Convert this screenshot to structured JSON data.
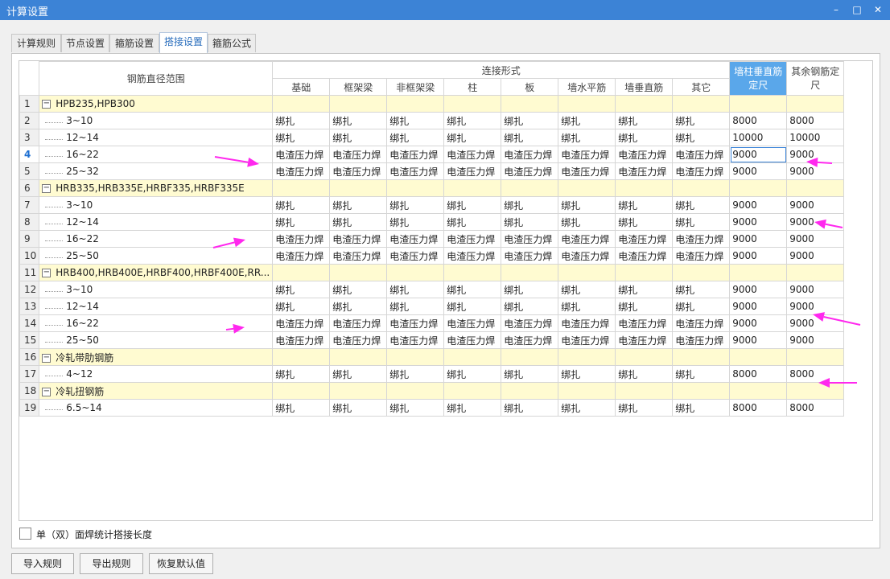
{
  "window": {
    "title": "计算设置",
    "minimize_icon": "minimize-icon",
    "maximize_icon": "maximize-icon",
    "close_icon": "close-icon",
    "accent": "#3c83d6"
  },
  "tabs": [
    {
      "label": "计算规则"
    },
    {
      "label": "节点设置"
    },
    {
      "label": "箍筋设置"
    },
    {
      "label": "搭接设置",
      "active": true
    },
    {
      "label": "箍筋公式"
    }
  ],
  "grid": {
    "header": {
      "range": "钢筋直径范围",
      "group": "连接形式",
      "cols": [
        "基础",
        "框架梁",
        "非框架梁",
        "柱",
        "板",
        "墙水平筋",
        "墙垂直筋",
        "其它"
      ],
      "wall_len": "墙柱垂直筋定尺",
      "other_len": "其余钢筋定尺"
    },
    "rows": [
      {
        "n": "1",
        "type": "group",
        "label": "HPB235,HPB300"
      },
      {
        "n": "2",
        "label": "3~10",
        "c": [
          "绑扎",
          "绑扎",
          "绑扎",
          "绑扎",
          "绑扎",
          "绑扎",
          "绑扎",
          "绑扎"
        ],
        "a": "8000",
        "b": "8000"
      },
      {
        "n": "3",
        "label": "12~14",
        "c": [
          "绑扎",
          "绑扎",
          "绑扎",
          "绑扎",
          "绑扎",
          "绑扎",
          "绑扎",
          "绑扎"
        ],
        "a": "10000",
        "b": "10000"
      },
      {
        "n": "4",
        "label": "16~22",
        "c": [
          "电渣压力焊",
          "电渣压力焊",
          "电渣压力焊",
          "电渣压力焊",
          "电渣压力焊",
          "电渣压力焊",
          "电渣压力焊",
          "电渣压力焊"
        ],
        "a": "9000",
        "b": "9000",
        "selected": true
      },
      {
        "n": "5",
        "label": "25~32",
        "c": [
          "电渣压力焊",
          "电渣压力焊",
          "电渣压力焊",
          "电渣压力焊",
          "电渣压力焊",
          "电渣压力焊",
          "电渣压力焊",
          "电渣压力焊"
        ],
        "a": "9000",
        "b": "9000"
      },
      {
        "n": "6",
        "type": "group",
        "label": "HRB335,HRB335E,HRBF335,HRBF335E"
      },
      {
        "n": "7",
        "label": "3~10",
        "c": [
          "绑扎",
          "绑扎",
          "绑扎",
          "绑扎",
          "绑扎",
          "绑扎",
          "绑扎",
          "绑扎"
        ],
        "a": "9000",
        "b": "9000"
      },
      {
        "n": "8",
        "label": "12~14",
        "c": [
          "绑扎",
          "绑扎",
          "绑扎",
          "绑扎",
          "绑扎",
          "绑扎",
          "绑扎",
          "绑扎"
        ],
        "a": "9000",
        "b": "9000"
      },
      {
        "n": "9",
        "label": "16~22",
        "c": [
          "电渣压力焊",
          "电渣压力焊",
          "电渣压力焊",
          "电渣压力焊",
          "电渣压力焊",
          "电渣压力焊",
          "电渣压力焊",
          "电渣压力焊"
        ],
        "a": "9000",
        "b": "9000"
      },
      {
        "n": "10",
        "label": "25~50",
        "c": [
          "电渣压力焊",
          "电渣压力焊",
          "电渣压力焊",
          "电渣压力焊",
          "电渣压力焊",
          "电渣压力焊",
          "电渣压力焊",
          "电渣压力焊"
        ],
        "a": "9000",
        "b": "9000"
      },
      {
        "n": "11",
        "type": "group",
        "label": "HRB400,HRB400E,HRBF400,HRBF400E,RR..."
      },
      {
        "n": "12",
        "label": "3~10",
        "c": [
          "绑扎",
          "绑扎",
          "绑扎",
          "绑扎",
          "绑扎",
          "绑扎",
          "绑扎",
          "绑扎"
        ],
        "a": "9000",
        "b": "9000"
      },
      {
        "n": "13",
        "label": "12~14",
        "c": [
          "绑扎",
          "绑扎",
          "绑扎",
          "绑扎",
          "绑扎",
          "绑扎",
          "绑扎",
          "绑扎"
        ],
        "a": "9000",
        "b": "9000"
      },
      {
        "n": "14",
        "label": "16~22",
        "c": [
          "电渣压力焊",
          "电渣压力焊",
          "电渣压力焊",
          "电渣压力焊",
          "电渣压力焊",
          "电渣压力焊",
          "电渣压力焊",
          "电渣压力焊"
        ],
        "a": "9000",
        "b": "9000"
      },
      {
        "n": "15",
        "label": "25~50",
        "c": [
          "电渣压力焊",
          "电渣压力焊",
          "电渣压力焊",
          "电渣压力焊",
          "电渣压力焊",
          "电渣压力焊",
          "电渣压力焊",
          "电渣压力焊"
        ],
        "a": "9000",
        "b": "9000"
      },
      {
        "n": "16",
        "type": "group",
        "label": "冷轧带肋钢筋"
      },
      {
        "n": "17",
        "label": "4~12",
        "c": [
          "绑扎",
          "绑扎",
          "绑扎",
          "绑扎",
          "绑扎",
          "绑扎",
          "绑扎",
          "绑扎"
        ],
        "a": "8000",
        "b": "8000"
      },
      {
        "n": "18",
        "type": "group",
        "label": "冷轧扭钢筋"
      },
      {
        "n": "19",
        "label": "6.5~14",
        "c": [
          "绑扎",
          "绑扎",
          "绑扎",
          "绑扎",
          "绑扎",
          "绑扎",
          "绑扎",
          "绑扎"
        ],
        "a": "8000",
        "b": "8000"
      }
    ]
  },
  "checkbox": {
    "label": "单（双）面焊统计搭接长度",
    "checked": false
  },
  "buttons": {
    "import": "导入规则",
    "export": "导出规则",
    "restore": "恢复默认值"
  },
  "annotation_color": "#ff28ee"
}
